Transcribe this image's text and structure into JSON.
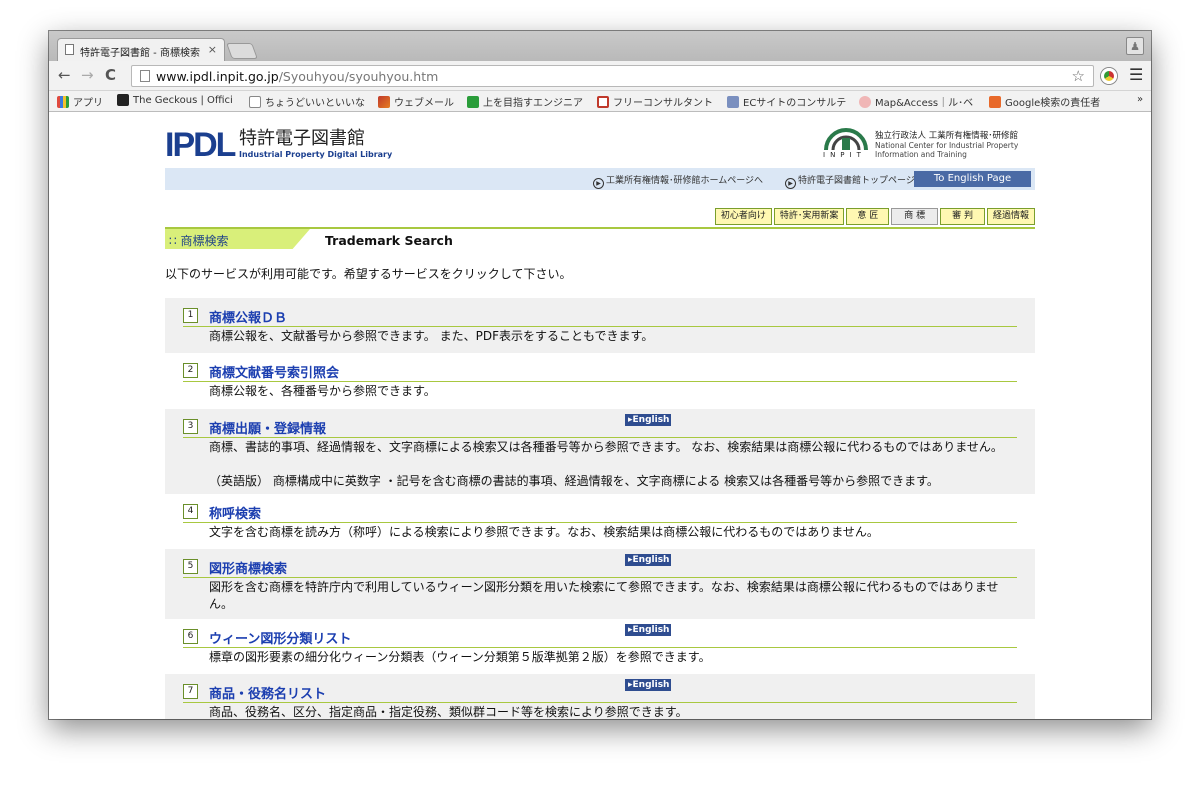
{
  "browser": {
    "tab_title": "特許電子図書館 - 商標検索",
    "tab_close": "×",
    "url_host": "www.ipdl.inpit.go.jp",
    "url_path": "/Syouhyou/syouhyou.htm",
    "bookmarks": [
      {
        "label": "アプリ",
        "color": "#e04a3f"
      },
      {
        "label": "The Geckous | Offici",
        "color": "#222222"
      },
      {
        "label": "ちょうどいいといいな",
        "color": "#ffffff"
      },
      {
        "label": "ウェブメール",
        "color": "#c0392b"
      },
      {
        "label": "上を目指すエンジニア",
        "color": "#2a9d3a"
      },
      {
        "label": "フリーコンサルタント",
        "color": "#c0392b"
      },
      {
        "label": "ECサイトのコンサルテ",
        "color": "#7a8fbf"
      },
      {
        "label": "Map&Access｜ル･ベ",
        "color": "#f0b6b6"
      },
      {
        "label": "Google検索の責任者",
        "color": "#e8692a"
      }
    ],
    "more": "»"
  },
  "header": {
    "logo_main": "IPDL",
    "logo_jp": "特許電子図書館",
    "logo_en": "Industrial Property Digital Library",
    "inpit_jp": "独立行政法人 工業所有権情報･研修館",
    "inpit_en1": "National Center for Industrial Property",
    "inpit_en2": "Information and Training",
    "inpit_letters": "INPIT"
  },
  "linkbar": {
    "home_link": "工業所有権情報･研修館ホームページへ",
    "top_link": "特許電子図書館トップページへ",
    "english": "To English Page"
  },
  "category_tabs": [
    "初心者向け",
    "特許･実用新案",
    "意 匠",
    "商 標",
    "審 判",
    "経過情報"
  ],
  "section": {
    "title_jp": "商標検索",
    "title_en": "Trademark Search",
    "intro": "以下のサービスが利用可能です。希望するサービスをクリックして下さい。"
  },
  "english_badge": "English",
  "services": [
    {
      "num": "1",
      "title": "商標公報ＤＢ",
      "desc": "商標公報を、文献番号から参照できます。 また、PDF表示をすることもできます。",
      "english": false
    },
    {
      "num": "2",
      "title": "商標文献番号索引照会",
      "desc": "商標公報を、各種番号から参照できます。",
      "english": false
    },
    {
      "num": "3",
      "title": "商標出願・登録情報",
      "desc": "商標、書誌的事項、経過情報を、文字商標による検索又は各種番号等から参照できます。 なお、検索結果は商標公報に代わるものではありません。",
      "desc2": "（英語版） 商標構成中に英数字 ・記号を含む商標の書誌的事項、経過情報を、文字商標による 検索又は各種番号等から参照できます。",
      "english": true
    },
    {
      "num": "4",
      "title": "称呼検索",
      "desc": "文字を含む商標を読み方（称呼）による検索により参照できます。なお、検索結果は商標公報に代わるものではありません。",
      "english": false
    },
    {
      "num": "5",
      "title": "図形商標検索",
      "desc": "図形を含む商標を特許庁内で利用しているウィーン図形分類を用いた検索にて参照できます。なお、検索結果は商標公報に代わるものではありません。",
      "english": true
    },
    {
      "num": "6",
      "title": "ウィーン図形分類リスト",
      "desc": "標章の図形要素の細分化ウィーン分類表（ウィーン分類第５版準拠第２版）を参照できます。",
      "english": true
    },
    {
      "num": "7",
      "title": "商品・役務名リスト",
      "desc": "商品、役務名、区分、指定商品・指定役務、類似群コード等を検索により参照できます。",
      "english": true
    }
  ]
}
